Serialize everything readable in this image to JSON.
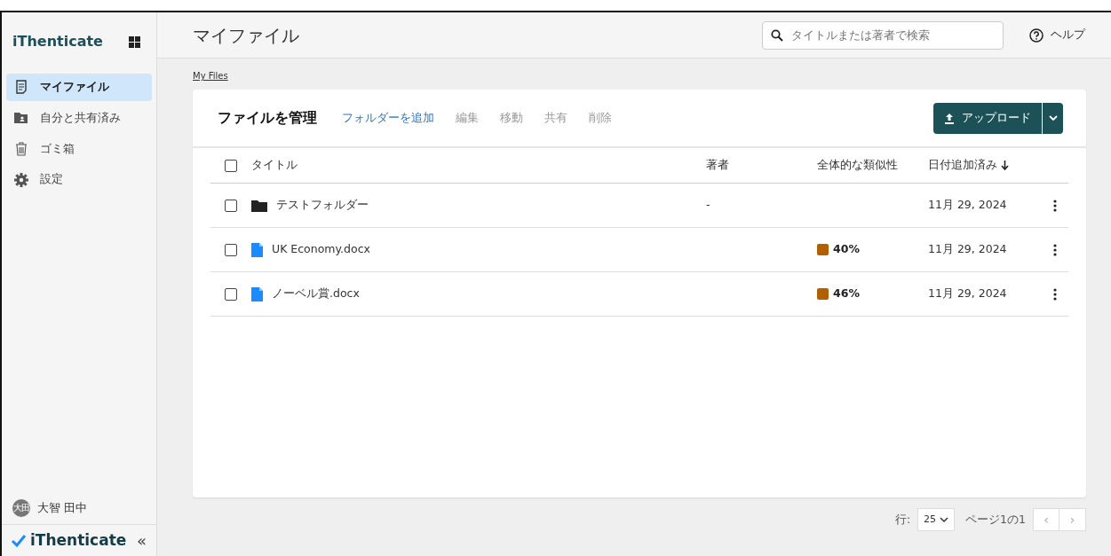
{
  "sidebar": {
    "brand": "iThenticate",
    "items": [
      {
        "label": "マイファイル",
        "selected": true
      },
      {
        "label": "自分と共有済み",
        "selected": false
      },
      {
        "label": "ゴミ箱",
        "selected": false
      },
      {
        "label": "設定",
        "selected": false
      }
    ],
    "user": {
      "initials": "大田",
      "name": "大智 田中"
    },
    "footer_brand": "iThenticate",
    "collapse": "«"
  },
  "header": {
    "title": "マイファイル",
    "search": {
      "placeholder": "タイトルまたは著者で検索"
    },
    "help": "ヘルプ"
  },
  "breadcrumb": "My Files",
  "panel": {
    "title": "ファイルを管理",
    "actions": [
      {
        "label": "フォルダーを追加",
        "disabled": false
      },
      {
        "label": "編集",
        "disabled": true
      },
      {
        "label": "移動",
        "disabled": true
      },
      {
        "label": "共有",
        "disabled": true
      },
      {
        "label": "削除",
        "disabled": true
      }
    ],
    "upload": "アップロード",
    "table": {
      "columns": [
        {
          "label": "タイトル",
          "sorted": false
        },
        {
          "label": "著者",
          "sorted": false
        },
        {
          "label": "全体的な類似性",
          "sorted": false
        },
        {
          "label": "日付追加済み",
          "sorted": true
        }
      ],
      "select_all_checked": false,
      "rows": [
        {
          "kind": "folder",
          "title": "テストフォルダー",
          "author": "-",
          "date": "11月 29, 2024",
          "checked": false
        },
        {
          "kind": "file",
          "title": "UK Economy.docx",
          "similarity": "40%",
          "color": "#b15f00",
          "date": "11月 29, 2024",
          "checked": false
        },
        {
          "kind": "file",
          "title": "ノーベル賞.docx",
          "similarity": "46%",
          "color": "#b15f00",
          "date": "11月 29, 2024",
          "checked": false
        }
      ]
    }
  },
  "pagination": {
    "rows_label": "行:",
    "rows_value": "25",
    "page_text": "ページ1の1",
    "prev": "‹",
    "next": "›"
  }
}
